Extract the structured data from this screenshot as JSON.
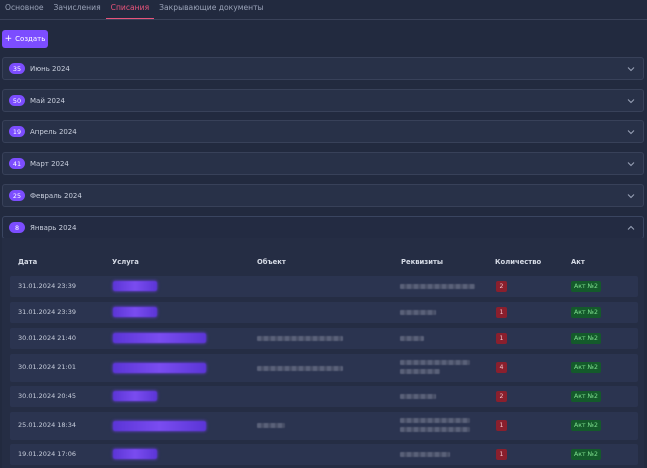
{
  "tabs": [
    {
      "label": "Основное",
      "active": false
    },
    {
      "label": "Зачисления",
      "active": false
    },
    {
      "label": "Списания",
      "active": true
    },
    {
      "label": "Закрывающие документы",
      "active": false
    }
  ],
  "create_button": {
    "label": "Создать"
  },
  "months": [
    {
      "count": "35",
      "label": "Июнь 2024",
      "open": false
    },
    {
      "count": "50",
      "label": "Май 2024",
      "open": false
    },
    {
      "count": "19",
      "label": "Апрель 2024",
      "open": false
    },
    {
      "count": "41",
      "label": "Март 2024",
      "open": false
    },
    {
      "count": "25",
      "label": "Февраль 2024",
      "open": false
    },
    {
      "count": "8",
      "label": "Январь 2024",
      "open": true
    }
  ],
  "table": {
    "headers": [
      "Дата",
      "Услуга",
      "Объект",
      "Реквизиты",
      "Количество",
      "Акт"
    ],
    "rows": [
      {
        "date": "31.01.2024 23:39",
        "qty": "2",
        "act": "Акт №2"
      },
      {
        "date": "31.01.2024 23:39",
        "qty": "1",
        "act": "Акт №2"
      },
      {
        "date": "30.01.2024 21:40",
        "qty": "1",
        "act": "Акт №2"
      },
      {
        "date": "30.01.2024 21:01",
        "qty": "4",
        "act": "Акт №2"
      },
      {
        "date": "30.01.2024 20:45",
        "qty": "2",
        "act": "Акт №2"
      },
      {
        "date": "25.01.2024 18:34",
        "qty": "1",
        "act": "Акт №2"
      },
      {
        "date": "19.01.2024 17:06",
        "qty": "1",
        "act": "Акт №2"
      }
    ]
  },
  "colors": {
    "accent": "#7c4dff",
    "active_tab": "#e9547b",
    "qty_badge": "#8a1f2d",
    "act_badge": "#145a2b"
  },
  "icons": {
    "accordion_collapsed": "chevron-down-icon",
    "accordion_expanded": "chevron-up-icon",
    "create": "plus-icon"
  }
}
